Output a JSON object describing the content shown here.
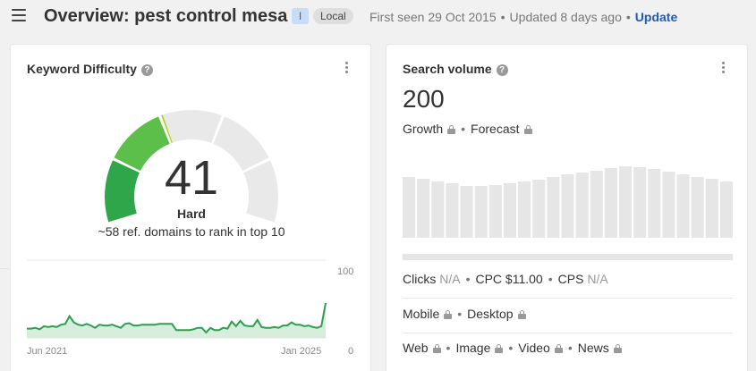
{
  "header": {
    "title": "Overview: pest control mesa",
    "badge_intent": "I",
    "badge_local": "Local",
    "first_seen": "First seen 29 Oct 2015",
    "updated": "Updated 8 days ago",
    "update_label": "Update"
  },
  "kd_card": {
    "title": "Keyword Difficulty",
    "value": "41",
    "level": "Hard",
    "subtitle": "~58 ref. domains to rank in top 10",
    "gauge_fraction": 0.41,
    "gauge_colors": {
      "dark_green": "#30a64a",
      "green": "#5cbf4a",
      "yellow_green": "#b5cf1a",
      "empty": "#e9e9e9"
    }
  },
  "chart_data": {
    "type": "area",
    "x_labels": [
      "Jun 2021",
      "Jan 2025"
    ],
    "y_ticks": [
      "100",
      "0"
    ],
    "ylim": [
      0,
      100
    ],
    "values": [
      12,
      12,
      13,
      11,
      15,
      14,
      15,
      14,
      17,
      18,
      28,
      20,
      17,
      16,
      18,
      16,
      13,
      17,
      16,
      16,
      17,
      15,
      13,
      18,
      19,
      16,
      16,
      17,
      17,
      17,
      17,
      18,
      18,
      18,
      18,
      10,
      10,
      10,
      10,
      11,
      13,
      13,
      7,
      13,
      10,
      10,
      13,
      12,
      21,
      15,
      22,
      16,
      15,
      15,
      23,
      14,
      13,
      13,
      14,
      13,
      16,
      16,
      20,
      17,
      17,
      15,
      16,
      14,
      13,
      15,
      45
    ],
    "color": "#2e9e4f"
  },
  "sv_card": {
    "title": "Search volume",
    "value": "200",
    "growth": "Growth",
    "forecast": "Forecast",
    "bars": [
      68,
      66,
      63,
      61,
      58,
      58,
      59,
      61,
      63,
      65,
      68,
      71,
      73,
      75,
      78,
      80,
      79,
      77,
      74,
      71,
      68,
      66,
      63
    ],
    "bar_color": "#e6e6e6",
    "clicks_label": "Clicks",
    "clicks_value": "N/A",
    "cpc": "CPC $11.00",
    "cps_label": "CPS",
    "cps_value": "N/A",
    "mobile": "Mobile",
    "desktop": "Desktop",
    "web": "Web",
    "image": "Image",
    "video": "Video",
    "news": "News"
  }
}
